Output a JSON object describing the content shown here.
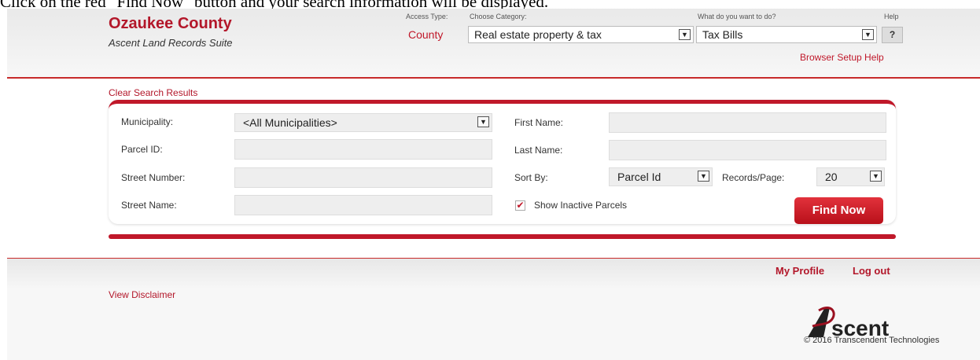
{
  "caption": "Click on the red \"Find Now\" button and your search information will be displayed.",
  "brand": {
    "title": "Ozaukee County",
    "subtitle": "Ascent Land Records Suite"
  },
  "header": {
    "access_type_label": "Access Type:",
    "access_type_value": "County",
    "category_label": "Choose Category:",
    "category_value": "Real estate property & tax",
    "action_label": "What do you want to do?",
    "action_value": "Tax Bills",
    "help_label": "Help",
    "help_button": "?",
    "browser_setup_link": "Browser Setup Help"
  },
  "search": {
    "clear_results_link": "Clear Search Results",
    "municipality_label": "Municipality:",
    "municipality_value": "<All Municipalities>",
    "parcel_id_label": "Parcel ID:",
    "street_number_label": "Street Number:",
    "street_name_label": "Street Name:",
    "first_name_label": "First Name:",
    "last_name_label": "Last Name:",
    "sort_by_label": "Sort By:",
    "sort_by_value": "Parcel Id",
    "records_page_label": "Records/Page:",
    "records_page_value": "20",
    "show_inactive_label": "Show Inactive Parcels",
    "show_inactive_checked": "✔",
    "find_button": "Find Now"
  },
  "footer": {
    "my_profile": "My Profile",
    "logout": "Log out",
    "disclaimer": "View Disclaimer",
    "logo_text": "scent",
    "copyright": "© 2016 Transcendent Technologies"
  },
  "colors": {
    "accent": "#c0182a",
    "header_bg": "#efefef"
  }
}
